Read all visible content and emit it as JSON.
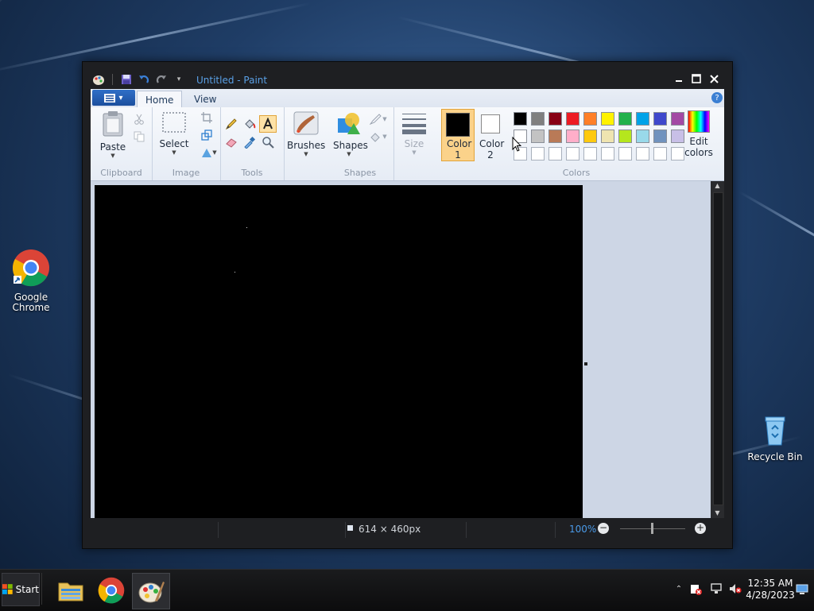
{
  "desktop": {
    "icons": [
      {
        "label": "Google Chrome",
        "icon": "chrome-icon"
      },
      {
        "label": "Recycle Bin",
        "icon": "recycle-bin-icon"
      }
    ]
  },
  "window": {
    "title": "Untitled - Paint",
    "controls": [
      "minimize",
      "maximize",
      "close"
    ]
  },
  "ribbon": {
    "tabs": [
      {
        "label": "Home",
        "active": true
      },
      {
        "label": "View",
        "active": false
      }
    ],
    "groups": {
      "clipboard": {
        "label": "Clipboard",
        "paste": "Paste"
      },
      "image": {
        "label": "Image",
        "select": "Select"
      },
      "tools": {
        "label": "Tools"
      },
      "brushes": {
        "label": "Brushes"
      },
      "shapes": {
        "label": "Shapes",
        "shapes_btn": "Shapes"
      },
      "size": {
        "label": "Size"
      },
      "colors": {
        "label": "Colors",
        "color1": "Color 1",
        "color2": "Color 2",
        "edit": "Edit colors",
        "color1_value": "#000000",
        "color2_value": "#ffffff",
        "palette_row1": [
          "#000000",
          "#7f7f7f",
          "#880015",
          "#ed1c24",
          "#ff7f27",
          "#fff200",
          "#22b14c",
          "#00a2e8",
          "#3f48cc",
          "#a349a4"
        ],
        "palette_row2": [
          "#ffffff",
          "#c3c3c3",
          "#b97a57",
          "#ffaec9",
          "#ffc90e",
          "#efe4b0",
          "#b5e61d",
          "#99d9ea",
          "#7092be",
          "#c8bfe7"
        ]
      }
    }
  },
  "statusbar": {
    "dimensions": "614 × 460px",
    "zoom": "100%"
  },
  "taskbar": {
    "start": "Start",
    "apps": [
      "file-explorer-icon",
      "chrome-icon",
      "paint-icon"
    ],
    "clock_time": "12:35 AM",
    "clock_date": "4/28/2023"
  }
}
